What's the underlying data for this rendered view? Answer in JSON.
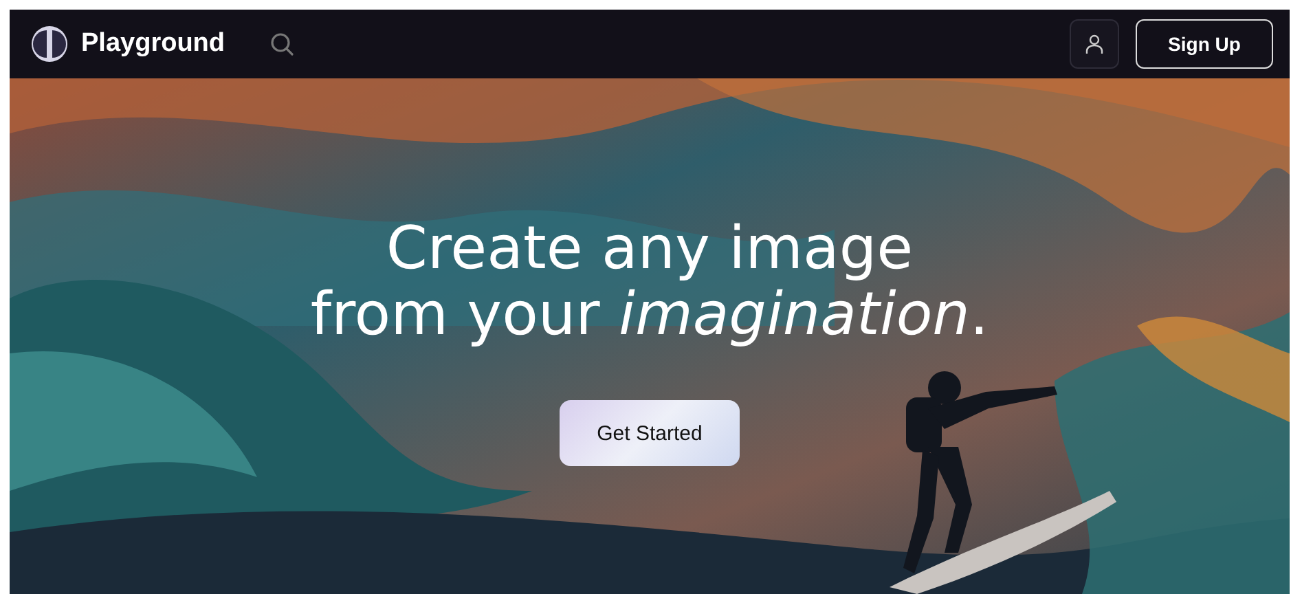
{
  "navbar": {
    "brand": "Playground",
    "signup": "Sign Up"
  },
  "hero": {
    "kind": "picture",
    "headline": [
      "Create any image",
      "from your *imagination*."
    ],
    "button": "Get Started"
  }
}
